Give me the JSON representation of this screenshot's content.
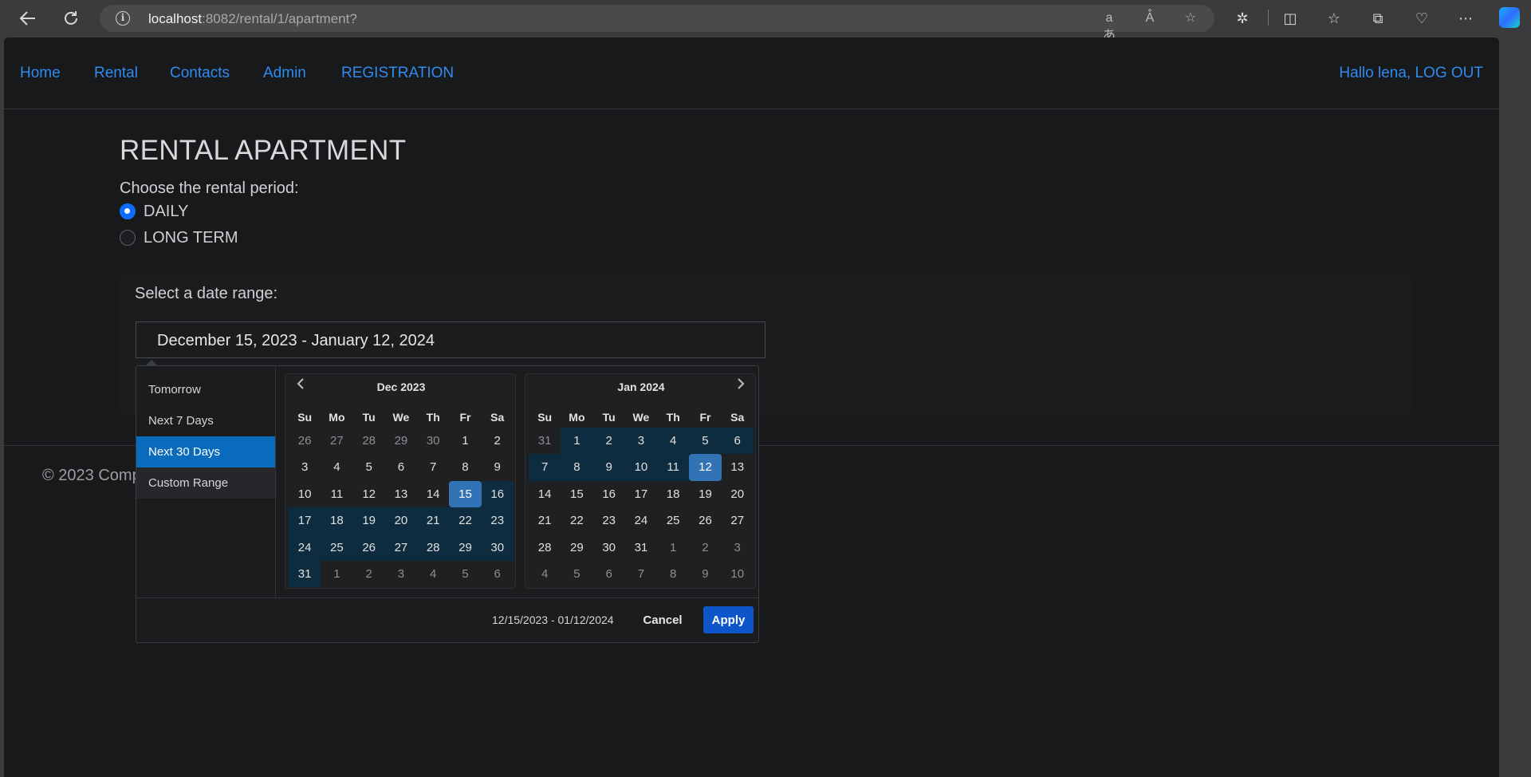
{
  "browser": {
    "url_host": "localhost",
    "url_path": ":8082/rental/1/apartment?"
  },
  "nav": {
    "items": [
      "Home",
      "Rental",
      "Contacts",
      "Admin",
      "REGISTRATION"
    ],
    "user_greeting": "Hallo lena, LOG OUT"
  },
  "page": {
    "title": "RENTAL APARTMENT",
    "period_prompt": "Choose the rental period:",
    "period_options": [
      {
        "label": "DAILY",
        "checked": true
      },
      {
        "label": "LONG TERM",
        "checked": false
      }
    ],
    "date_range_label": "Select a date range:",
    "date_range_value": "December 15, 2023 - January 12, 2024",
    "footer_text": "© 2023 Comp"
  },
  "picker": {
    "ranges": [
      "Tomorrow",
      "Next 7 Days",
      "Next 30 Days",
      "Custom Range"
    ],
    "active_range": "Next 30 Days",
    "weekdays": [
      "Su",
      "Mo",
      "Tu",
      "We",
      "Th",
      "Fr",
      "Sa"
    ],
    "left": {
      "month": "Dec 2023",
      "days": [
        "26",
        "27",
        "28",
        "29",
        "30",
        "1",
        "2",
        "3",
        "4",
        "5",
        "6",
        "7",
        "8",
        "9",
        "10",
        "11",
        "12",
        "13",
        "14",
        "15",
        "16",
        "17",
        "18",
        "19",
        "20",
        "21",
        "22",
        "23",
        "24",
        "25",
        "26",
        "27",
        "28",
        "29",
        "30",
        "31",
        "1",
        "2",
        "3",
        "4",
        "5",
        "6"
      ]
    },
    "right": {
      "month": "Jan 2024",
      "days": [
        "31",
        "1",
        "2",
        "3",
        "4",
        "5",
        "6",
        "7",
        "8",
        "9",
        "10",
        "11",
        "12",
        "13",
        "14",
        "15",
        "16",
        "17",
        "18",
        "19",
        "20",
        "21",
        "22",
        "23",
        "24",
        "25",
        "26",
        "27",
        "28",
        "29",
        "30",
        "31",
        "1",
        "2",
        "3",
        "4",
        "5",
        "6",
        "7",
        "8",
        "9",
        "10"
      ]
    },
    "selected_text": "12/15/2023 - 01/12/2024",
    "cancel_label": "Cancel",
    "apply_label": "Apply"
  }
}
